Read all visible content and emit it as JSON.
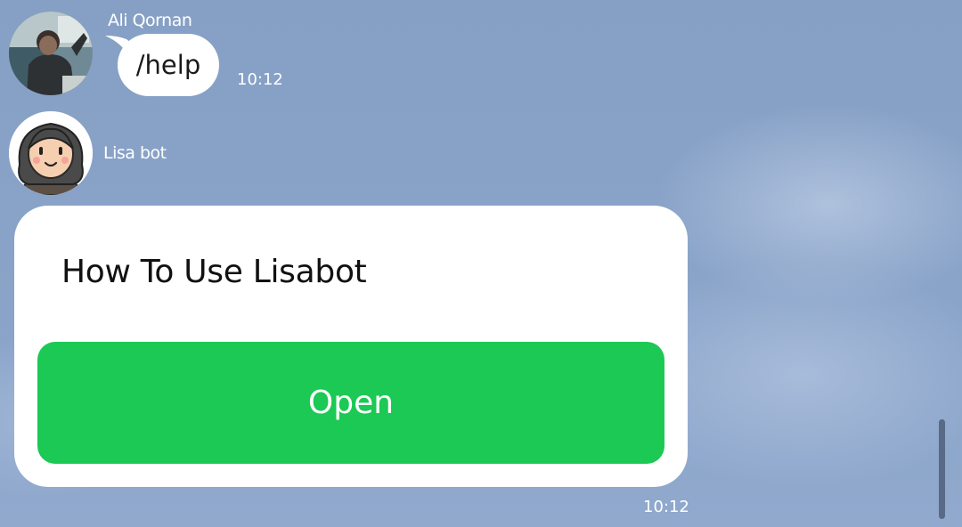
{
  "messages": {
    "user_message": {
      "sender": "Ali Qornan",
      "text": "/help",
      "time": "10:12",
      "avatar_icon": "user-photo-avatar"
    },
    "bot_message": {
      "sender": "Lisa bot",
      "time": "10:12",
      "avatar_icon": "lisa-bot-avatar",
      "card": {
        "title": "How To Use Lisabot",
        "button_label": "Open"
      }
    }
  },
  "colors": {
    "background": "#87a1c6",
    "button": "#1bc954",
    "bubble": "#ffffff",
    "text_light": "#ffffff"
  }
}
